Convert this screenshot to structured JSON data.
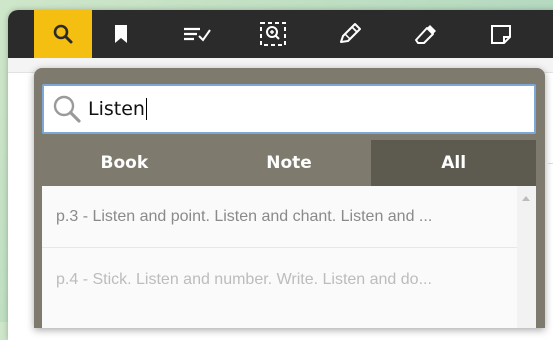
{
  "toolbar": {
    "buttons": [
      {
        "icon": "search-icon",
        "active": true
      },
      {
        "icon": "bookmark-icon",
        "active": false
      },
      {
        "icon": "list-check-icon",
        "active": false
      },
      {
        "icon": "zoom-select-icon",
        "active": false
      },
      {
        "icon": "pencil-icon",
        "active": false
      },
      {
        "icon": "eraser-icon",
        "active": false
      },
      {
        "icon": "note-icon",
        "active": false
      }
    ],
    "active_color": "#f5bf12",
    "background": "#2b2b2b"
  },
  "search": {
    "value": "Listen",
    "border_color": "#7fa7d6"
  },
  "tabs": [
    {
      "label": "Book",
      "active": false
    },
    {
      "label": "Note",
      "active": false
    },
    {
      "label": "All",
      "active": true
    }
  ],
  "results": [
    {
      "text": "p.3 - Listen and point. Listen and chant. Listen and ..."
    },
    {
      "text": "p.4 - Stick. Listen and number. Write. Listen and do..."
    }
  ]
}
